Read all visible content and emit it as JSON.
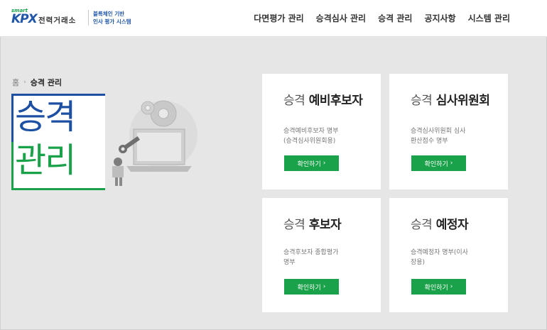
{
  "header": {
    "logo_small": "smart",
    "logo_main": "KPX",
    "org_name": "전력거래소",
    "subtitle_line1": "블록체인 기반",
    "subtitle_line2": "인사 평가 시스템",
    "nav": [
      "다면평가 관리",
      "승격심사 관리",
      "승격 관리",
      "공지사항",
      "시스템 관리"
    ]
  },
  "breadcrumb": {
    "home": "홈",
    "current": "승격 관리"
  },
  "page_title": {
    "line1": "승격",
    "line2": "관리"
  },
  "cards": [
    {
      "title_light": "승격",
      "title_bold": "예비후보자",
      "desc1": "승격예비후보자 명부",
      "desc2": "(승격심사위원회용)",
      "button": "확인하기"
    },
    {
      "title_light": "승격",
      "title_bold": "심사위원회",
      "desc1": "승격심사위원회 심사",
      "desc2": "환산점수 명부",
      "button": "확인하기"
    },
    {
      "title_light": "승격",
      "title_bold": "후보자",
      "desc1": "승격후보자 종합평가",
      "desc2": "명부",
      "button": "확인하기"
    },
    {
      "title_light": "승격",
      "title_bold": "예정자",
      "desc1": "승격예정자 명부(이사",
      "desc2": "장용)",
      "button": "확인하기"
    }
  ],
  "colors": {
    "brand_blue": "#1d4fa3",
    "brand_green": "#1aa24a",
    "background": "#e6e6e6"
  }
}
